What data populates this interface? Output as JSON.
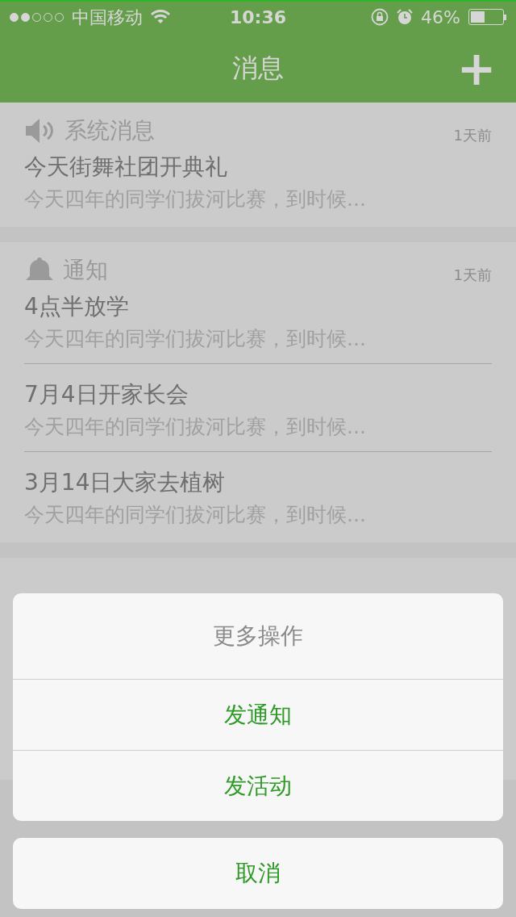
{
  "status_bar": {
    "carrier": "中国移动",
    "time": "10:36",
    "battery": "46%"
  },
  "nav": {
    "title": "消息",
    "add_button": "+"
  },
  "groups": [
    {
      "kind": "system",
      "title": "系统消息",
      "time": "1天前",
      "items": [
        {
          "title": "今天街舞社团开典礼",
          "summary": "今天四年的同学们拔河比赛，到时候..."
        }
      ]
    },
    {
      "kind": "notice",
      "title": "通知",
      "time": "1天前",
      "items": [
        {
          "title": "4点半放学",
          "summary": "今天四年的同学们拔河比赛，到时候..."
        },
        {
          "title": "7月4日开家长会",
          "summary": "今天四年的同学们拔河比赛，到时候..."
        },
        {
          "title": "3月14日大家去植树",
          "summary": "今天四年的同学们拔河比赛，到时候..."
        }
      ]
    }
  ],
  "action_sheet": {
    "title": "更多操作",
    "actions": [
      "发通知",
      "发活动"
    ],
    "cancel": "取消"
  }
}
